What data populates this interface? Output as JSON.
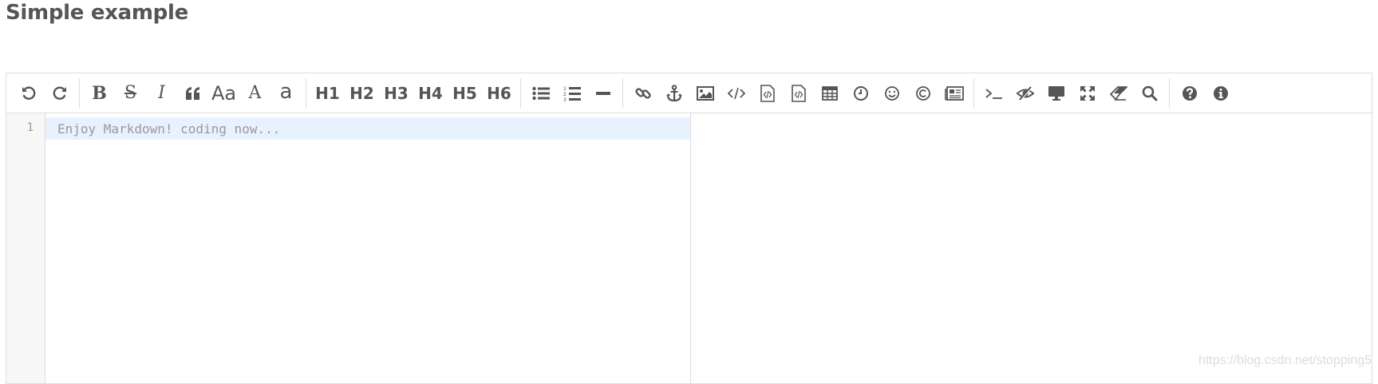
{
  "page": {
    "title": "Simple example"
  },
  "toolbar": {
    "groups": [
      [
        {
          "name": "undo-button",
          "icon": "undo-icon"
        },
        {
          "name": "redo-button",
          "icon": "redo-icon"
        }
      ],
      [
        {
          "name": "bold-button",
          "label": "B",
          "style": "serif-bold"
        },
        {
          "name": "strikethrough-button",
          "label": "S",
          "style": "serif-strike"
        },
        {
          "name": "italic-button",
          "label": "I",
          "style": "serif-italic"
        },
        {
          "name": "quote-button",
          "icon": "quote-icon"
        },
        {
          "name": "uppercase-button",
          "label": "Aa",
          "style": "sans-light"
        },
        {
          "name": "ucfirst-button",
          "label": "A",
          "style": "serif-plain"
        },
        {
          "name": "lowercase-button",
          "label": "a",
          "style": "sans-light"
        }
      ],
      [
        {
          "name": "h1-button",
          "label": "H1"
        },
        {
          "name": "h2-button",
          "label": "H2"
        },
        {
          "name": "h3-button",
          "label": "H3"
        },
        {
          "name": "h4-button",
          "label": "H4"
        },
        {
          "name": "h5-button",
          "label": "H5"
        },
        {
          "name": "h6-button",
          "label": "H6"
        }
      ],
      [
        {
          "name": "unordered-list-button",
          "icon": "list-ul-icon"
        },
        {
          "name": "ordered-list-button",
          "icon": "list-ol-icon"
        },
        {
          "name": "horizontal-rule-button",
          "icon": "minus-icon"
        }
      ],
      [
        {
          "name": "link-button",
          "icon": "link-icon"
        },
        {
          "name": "anchor-button",
          "icon": "anchor-icon"
        },
        {
          "name": "image-button",
          "icon": "image-icon"
        },
        {
          "name": "inline-code-button",
          "icon": "code-icon"
        },
        {
          "name": "code-block-button",
          "icon": "file-code-icon"
        },
        {
          "name": "preformatted-text-button",
          "icon": "file-code-icon"
        },
        {
          "name": "table-button",
          "icon": "table-icon"
        },
        {
          "name": "datetime-button",
          "icon": "clock-icon"
        },
        {
          "name": "emoji-button",
          "icon": "smile-icon"
        },
        {
          "name": "html-entities-button",
          "icon": "copyright-icon"
        },
        {
          "name": "pagebreak-button",
          "icon": "newspaper-icon"
        }
      ],
      [
        {
          "name": "goto-line-button",
          "icon": "terminal-icon"
        },
        {
          "name": "toggle-preview-button",
          "icon": "eye-slash-icon"
        },
        {
          "name": "html-preview-button",
          "icon": "desktop-icon"
        },
        {
          "name": "fullscreen-button",
          "icon": "expand-icon"
        },
        {
          "name": "clear-button",
          "icon": "eraser-icon"
        },
        {
          "name": "search-button",
          "icon": "search-icon"
        }
      ],
      [
        {
          "name": "help-button",
          "icon": "question-circle-icon"
        },
        {
          "name": "info-button",
          "icon": "info-circle-icon"
        }
      ]
    ]
  },
  "editor": {
    "line_number": "1",
    "placeholder": "Enjoy Markdown! coding now..."
  },
  "watermark": "https://blog.csdn.net/stopping5",
  "colors": {
    "icon": "#555555",
    "border": "#dddddd",
    "active_line": "#e8f2fe",
    "gutter": "#f7f7f7"
  }
}
